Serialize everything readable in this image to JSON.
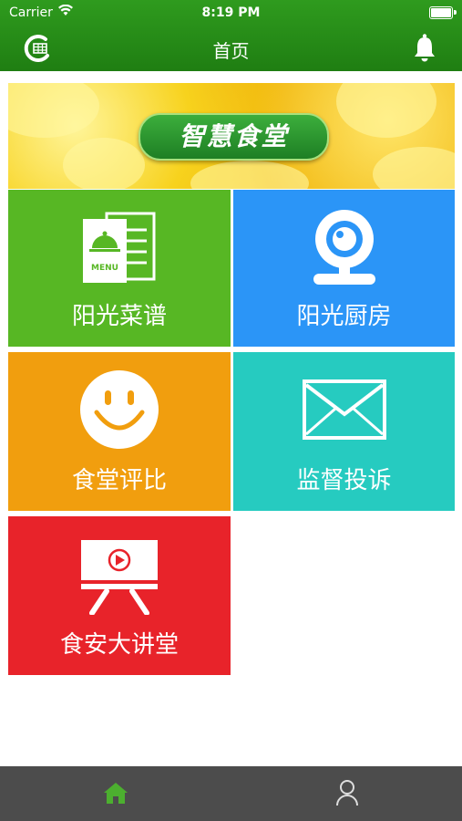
{
  "status": {
    "carrier": "Carrier",
    "time": "8:19 PM"
  },
  "nav": {
    "title": "首页"
  },
  "banner": {
    "logo_text": "智慧食堂"
  },
  "tiles": [
    {
      "label": "阳光菜谱",
      "color": "#57b724",
      "icon": "menu-icon",
      "menu_text": "MENU"
    },
    {
      "label": "阳光厨房",
      "color": "#2b95f7",
      "icon": "camera-icon"
    },
    {
      "label": "食堂评比",
      "color": "#f19e0e",
      "icon": "smiley-icon"
    },
    {
      "label": "监督投诉",
      "color": "#26cbc0",
      "icon": "envelope-icon"
    },
    {
      "label": "食安大讲堂",
      "color": "#e8232a",
      "icon": "video-board-icon"
    }
  ],
  "tabbar": {
    "active_color": "#4caf2f",
    "inactive_color": "#dddddd",
    "tabs": [
      {
        "icon": "home-icon"
      },
      {
        "icon": "user-icon"
      }
    ]
  }
}
